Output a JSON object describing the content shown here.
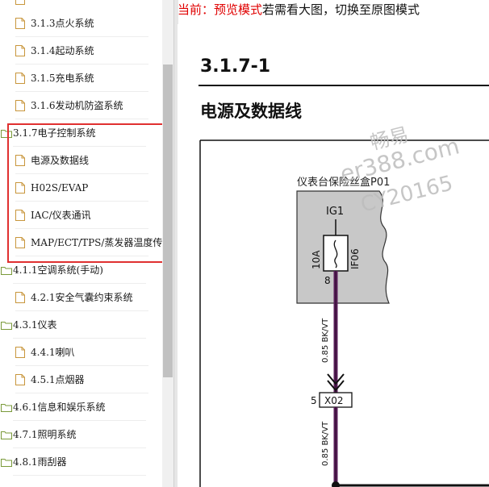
{
  "sidebar": {
    "items": [
      {
        "label": "3.1.3点火系统",
        "kind": "file"
      },
      {
        "label": "3.1.4起动系统",
        "kind": "file"
      },
      {
        "label": "3.1.5充电系统",
        "kind": "file"
      },
      {
        "label": "3.1.6发动机防盗系统",
        "kind": "file"
      },
      {
        "label": "3.1.7电子控制系统",
        "kind": "folder"
      },
      {
        "label": "电源及数据线",
        "kind": "file"
      },
      {
        "label": "H02S/EVAP",
        "kind": "file"
      },
      {
        "label": "IAC/仪表通讯",
        "kind": "file"
      },
      {
        "label": "MAP/ECT/TPS/蒸发器温度传",
        "kind": "file"
      },
      {
        "label": "4.1.1空调系统(手动)",
        "kind": "folder"
      },
      {
        "label": "4.2.1安全气囊约束系统",
        "kind": "file"
      },
      {
        "label": "4.3.1仪表",
        "kind": "folder"
      },
      {
        "label": "4.4.1喇叭",
        "kind": "file"
      },
      {
        "label": "4.5.1点烟器",
        "kind": "file"
      },
      {
        "label": "4.6.1信息和娱乐系统",
        "kind": "folder"
      },
      {
        "label": "4.7.1照明系统",
        "kind": "folder"
      },
      {
        "label": "4.8.1雨刮器",
        "kind": "folder"
      }
    ]
  },
  "banner": {
    "prefix": "当前：预览模式",
    "rest": "若需看大图，切换至原图模式"
  },
  "document": {
    "section_number": "3.1.7-1",
    "section_title": "电源及数据线"
  },
  "diagram": {
    "box_label": "仪表台保险丝盒P01",
    "ig_label": "IG1",
    "fuse_rating": "10A",
    "fuse_id": "IF06",
    "pin_top": "8",
    "wire_label_1": "0.85 BK/VT",
    "connector_pin": "5",
    "connector_id": "X02",
    "wire_label_2": "0.85 BK/VT"
  },
  "watermark": {
    "line1": "畅易",
    "line2": "er388.com",
    "line3": "CY20165"
  },
  "colors": {
    "highlight": "#e03030",
    "banner_red": "#e00000",
    "wire": "#5a1e5a",
    "box_fill": "#c8c8c8"
  }
}
